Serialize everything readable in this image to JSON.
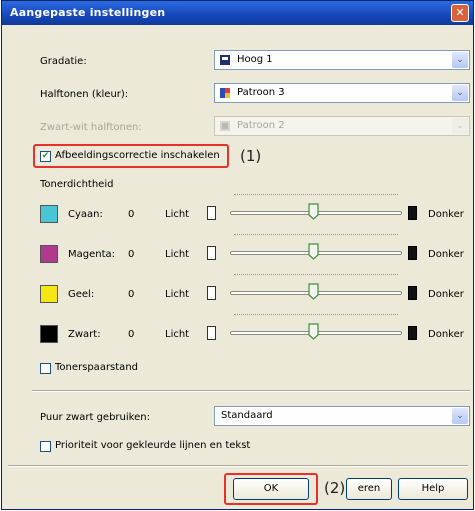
{
  "window": {
    "title": "Aangepaste instellingen",
    "close_glyph": "✕"
  },
  "gradatie": {
    "label": "Gradatie:",
    "value": "Hoog 1",
    "icon": "printer-icon"
  },
  "halftonen": {
    "label": "Halftonen (kleur):",
    "value": "Patroon 3",
    "icon": "palette-icon"
  },
  "zwartwit": {
    "label": "Zwart-wit halftonen:",
    "value": "Patroon 2",
    "icon": "palette-icon"
  },
  "correctie": {
    "label": "Afbeeldingscorrectie inschakelen",
    "checked": true,
    "callout": "(1)"
  },
  "toner": {
    "title": "Tonerdichtheid",
    "light_label": "Licht",
    "dark_label": "Donker",
    "rows": [
      {
        "name": "Cyaan:",
        "value": "0",
        "color": "#49c6d6"
      },
      {
        "name": "Magenta:",
        "value": "0",
        "color": "#b03a8e"
      },
      {
        "name": "Geel:",
        "value": "0",
        "color": "#f5e614"
      },
      {
        "name": "Zwart:",
        "value": "0",
        "color": "#000000"
      }
    ]
  },
  "tonerspaar": {
    "label": "Tonerspaarstand",
    "checked": false
  },
  "puurzwart": {
    "label": "Puur zwart gebruiken:",
    "value": "Standaard"
  },
  "prioriteit": {
    "label": "Prioriteit voor gekleurde lijnen en tekst",
    "checked": false
  },
  "buttons": {
    "ok": "OK",
    "cancel_partial": "eren",
    "help": "Help",
    "callout": "(2)"
  },
  "arrow_glyph": "⌄"
}
